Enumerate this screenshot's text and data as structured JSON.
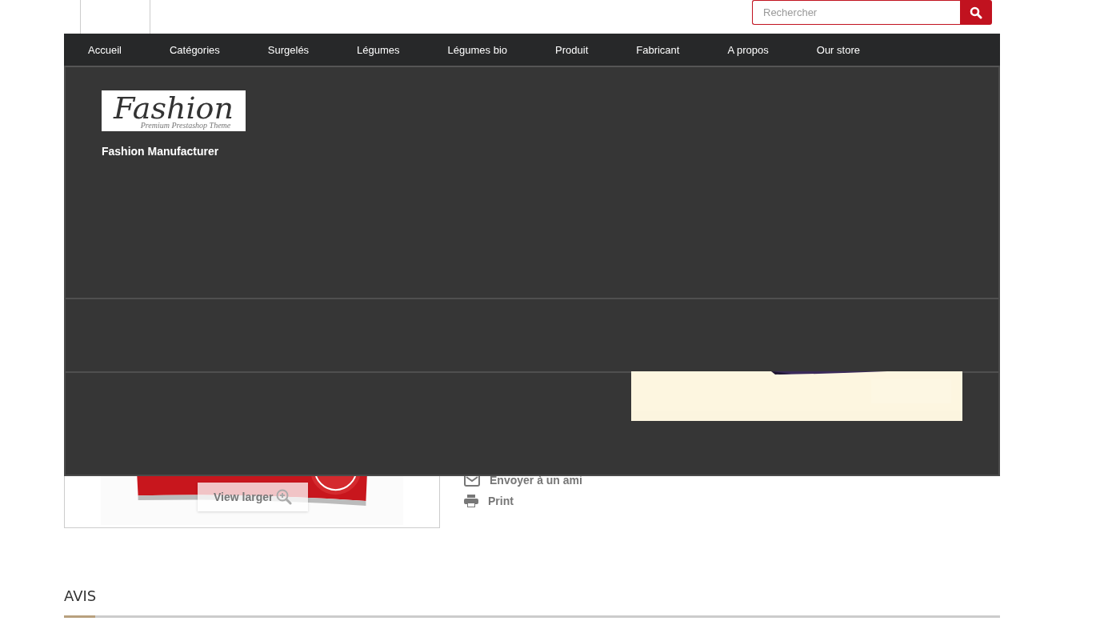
{
  "search": {
    "placeholder": "Rechercher"
  },
  "nav": {
    "items": [
      {
        "label": "Accueil"
      },
      {
        "label": "Catégories"
      },
      {
        "label": "Surgelés"
      },
      {
        "label": "Légumes"
      },
      {
        "label": "Légumes bio"
      },
      {
        "label": "Produit"
      },
      {
        "label": "Fabricant"
      },
      {
        "label": "A propos"
      },
      {
        "label": "Our store"
      }
    ]
  },
  "mega_menu": {
    "logo": {
      "title": "Fashion",
      "tagline": "Premium Prestashop Theme"
    },
    "manufacturer": "Fashion Manufacturer"
  },
  "product": {
    "view_larger": "View larger",
    "links": [
      {
        "kind": "mail",
        "label": "Envoyer à un ami"
      },
      {
        "kind": "print",
        "label": "Print"
      }
    ]
  },
  "reviews": {
    "title": "AVIS"
  }
}
